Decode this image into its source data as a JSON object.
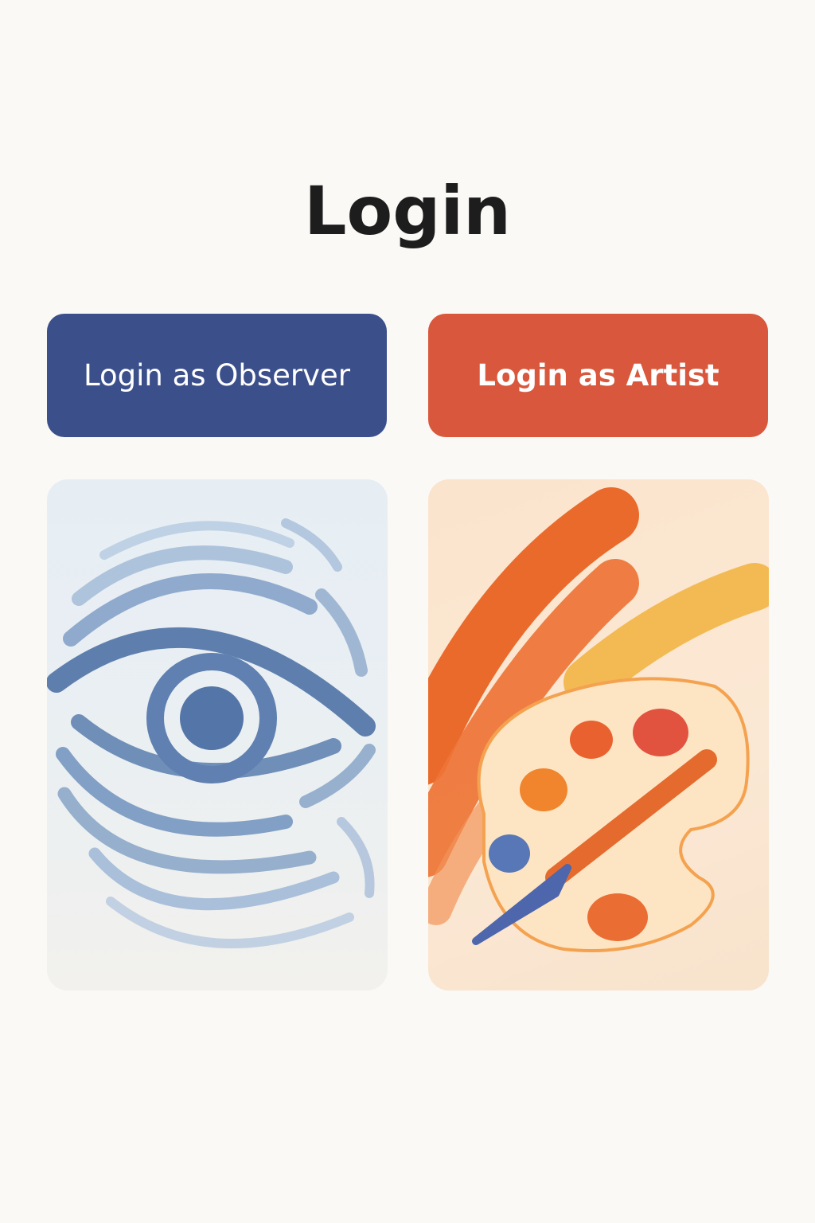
{
  "page": {
    "title": "Login"
  },
  "buttons": {
    "observer_label": "Login as Observer",
    "artist_label": "Login as Artist"
  },
  "cards": {
    "observer_illustration": "eye-icon",
    "artist_illustration": "paint-palette-icon"
  },
  "colors": {
    "background": "#fbf9f6",
    "observer_accent": "#3b4f8b",
    "artist_accent": "#d9573c",
    "title_text": "#1d1d1d",
    "button_text": "#ffffff"
  }
}
